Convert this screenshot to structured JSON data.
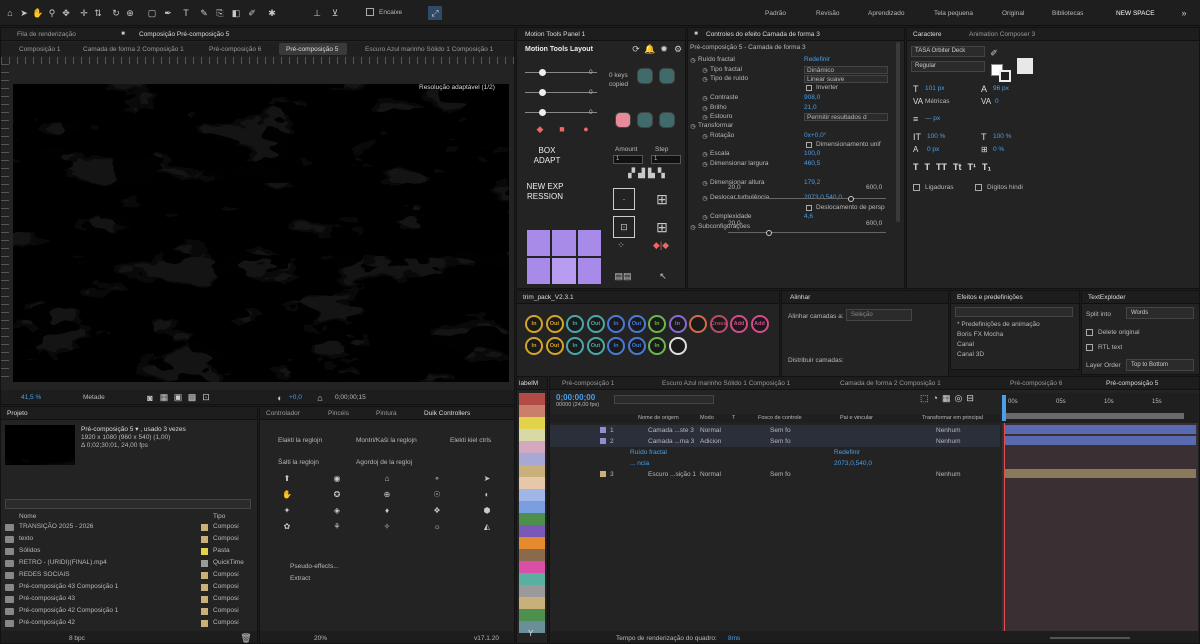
{
  "toolbar": {
    "encaixe": "Encaixe",
    "workspaces": [
      "Padrão",
      "Revisão",
      "Aprendizado",
      "Tela pequena",
      "Original",
      "Bibliotecas",
      "NEW SPACE"
    ]
  },
  "viewer": {
    "tabs": [
      "Fila de renderização",
      "Composição Pré-composição 5"
    ],
    "breadcrumbs": [
      "Composição 1",
      "Camada de forma 2 Composição 1",
      "Pré-composição 6",
      "Pré-composição 5",
      "Escuro Azul marinho Sólido 1 Composição 1"
    ],
    "resolution_label": "Resolução adaptável (1/2)",
    "zoom": "41,5 %",
    "quality": "Metade",
    "exposure": "+0,0",
    "timecode": "0;00;00;15"
  },
  "motion_tools": {
    "tab": "Motion Tools Panel 1",
    "layout": "Motion Tools Layout",
    "slider_values": [
      "0",
      "0",
      "0"
    ],
    "keys_copied": "0 keys copied",
    "box_adapt": "BOX ADAPT",
    "new_expression": "NEW EXPRESSION",
    "amount_label": "Amount",
    "step_label": "Step",
    "amount": "1",
    "step": "1"
  },
  "effects": {
    "tab": "Controles do efeito Camada de forma 3",
    "header": "Pré-composição 5 - Camada de forma 3",
    "rows": [
      {
        "label": "Ruído fractal",
        "value": "Redefinir"
      },
      {
        "label": "Tipo fractal",
        "value": "Dinâmico"
      },
      {
        "label": "Tipo de ruído",
        "value": "Linear suave"
      },
      {
        "label": "",
        "value": "Inverter"
      },
      {
        "label": "Contraste",
        "value": "908,0"
      },
      {
        "label": "Brilho",
        "value": "21,0"
      },
      {
        "label": "Estouro",
        "value": "Permitir resultados d"
      },
      {
        "label": "Transformar",
        "value": ""
      },
      {
        "label": "Rotação",
        "value": "0x+0,0°"
      },
      {
        "label": "",
        "value": "Dimensionamento unif"
      },
      {
        "label": "Escala",
        "value": "100,0"
      },
      {
        "label": "Dimensionar largura",
        "value": "460,5"
      },
      {
        "label": "Dimensionar altura",
        "value": "179,2"
      },
      {
        "label": "Deslocar turbulência",
        "value": "2073,0,540,0"
      },
      {
        "label": "",
        "value": "Deslocamento de persp"
      },
      {
        "label": "Complexidade",
        "value": "4,6"
      },
      {
        "label": "Subconfigurações",
        "value": ""
      }
    ],
    "range_min": "20,0",
    "range_max": "600,0"
  },
  "character": {
    "tabs": [
      "Caractere",
      "Animation Composer 3"
    ],
    "font": "TASA Orbiter Deck",
    "style": "Regular",
    "size": "101 px",
    "leading": "96 px",
    "kerning": "Métricas",
    "tracking": "0",
    "stroke": "— px",
    "vscale": "100 %",
    "hscale": "100 %",
    "baseline": "0 px",
    "tsume": "0 %",
    "ligatures": "Ligaduras",
    "hindi": "Dígitos hindi"
  },
  "trim": {
    "tab": "trim_pack_V2.3.1",
    "buttons": [
      "In",
      "Out",
      "In",
      "Out",
      "In",
      "Out",
      "In",
      "In",
      "",
      "Cross",
      "Add",
      "Add",
      "In",
      "Out",
      "In",
      "Out",
      "In",
      "Out",
      "In",
      ""
    ]
  },
  "align": {
    "tab": "Alinhar",
    "align_to_label": "Alinhar camadas a:",
    "align_to_value": "Seleção",
    "distribute": "Distribuir camadas:"
  },
  "effects_presets": {
    "tab": "Efeitos e predefinições",
    "items": [
      "* Predefinições de animação",
      "Boris FX Mocha",
      "Canal",
      "Canal 3D"
    ]
  },
  "text_exploder": {
    "tab": "TextExploder",
    "split_into": "Split into",
    "split_value": "Words",
    "delete_original": "Delete original",
    "rtl": "RTL text",
    "layer_order": "Layer Order",
    "layer_order_value": "Top to Bottom"
  },
  "project": {
    "tab": "Projeto",
    "comp_name": "Pré-composição 5 ▾ , usado 3 vezes",
    "comp_size": "1920 x 1080  (960 x 540) (1,00)",
    "comp_duration": "Δ 0;02;30;01, 24,00 fps",
    "col_name": "Nome",
    "col_type": "Tipo",
    "bpc": "8 bpc",
    "items": [
      {
        "name": "TRANSIÇÃO 2025 - 2026",
        "type": "Composi",
        "color": "#c9b07a"
      },
      {
        "name": "texto",
        "type": "Composi",
        "color": "#c9b07a"
      },
      {
        "name": "Sólidos",
        "type": "Pasta",
        "color": "#e3d34a"
      },
      {
        "name": "RETRO - (URIDI)(FINAL).mp4",
        "type": "QuickTime",
        "color": "#9a9a9a"
      },
      {
        "name": "REDES SOCIAIS",
        "type": "Composi",
        "color": "#c9b07a"
      },
      {
        "name": "Pré-composição 43 Composição 1",
        "type": "Composi",
        "color": "#c9b07a"
      },
      {
        "name": "Pré-composição 43",
        "type": "Composi",
        "color": "#c9b07a"
      },
      {
        "name": "Pré-composição 42 Composição 1",
        "type": "Composi",
        "color": "#c9b07a"
      },
      {
        "name": "Pré-composição 42",
        "type": "Composi",
        "color": "#c9b07a"
      }
    ]
  },
  "duik": {
    "tabs": [
      "Controlador",
      "Pincéis",
      "Pintura",
      "Duik Controllers"
    ],
    "a": "Elakti la reglojn",
    "b": "Montri/Kaŝi la reglojn",
    "c": "Elekti kiel ctrls",
    "d": "Ŝalti la reglojn",
    "e": "Agordoj de la regloj",
    "pseudo": "Pseudo-effects...",
    "extract": "Extract",
    "version": "v17.1.20",
    "percent": "20%"
  },
  "labels": {
    "tab": "labelM",
    "colors": [
      "#b24b46",
      "#c97f6a",
      "#e3d34a",
      "#d9d9a8",
      "#d4a8bf",
      "#a8a8d4",
      "#c9b07a",
      "#e6c8a8",
      "#9fb6e6",
      "#7a9fe0",
      "#4d8f4d",
      "#7a58b8",
      "#e68a2e",
      "#8a6a4a",
      "#d94fa8",
      "#5ab0a0",
      "#9a9a9a",
      "#c9b07a",
      "#4d8f4d",
      "#6a8f9a"
    ],
    "bottom": "Y"
  },
  "timeline": {
    "tabs": [
      "Pré-composição 1",
      "Escuro Azul marinho Sólido 1 Composição 1",
      "Camada de forma 2 Composição 1",
      "Pré-composição 6",
      "Pré-composição 5"
    ],
    "timecode": "0;00:00;00",
    "frames": "00000 (24,00 fps)",
    "cols": [
      "Nome de origem",
      "Modo",
      "T",
      "Fosco de controle",
      "Pai e vincular",
      "Transformar em principal"
    ],
    "ruler": [
      "00s",
      "05s",
      "10s",
      "15s"
    ],
    "layers": [
      {
        "num": "1",
        "name": "Camada ...ste 3",
        "mode": "Normal",
        "matte": "Sem fo",
        "parent": "Nenhum",
        "color": "#8f8fd0"
      },
      {
        "num": "2",
        "name": "Camada ...ma 3",
        "mode": "Adicion",
        "matte": "Sem fo",
        "parent": "Nenhum",
        "color": "#8f8fd0"
      },
      {
        "num": "",
        "name": "Ruído fractal",
        "mode": "",
        "matte": "Redefinir",
        "parent": "",
        "color": ""
      },
      {
        "num": "",
        "name": "... ncia",
        "mode": "",
        "matte": "2073,0,540,0",
        "parent": "",
        "color": ""
      },
      {
        "num": "3",
        "name": "Escuro ...sição 1",
        "mode": "Normal",
        "matte": "Sem fo",
        "parent": "Nenhum",
        "color": "#c9b07a"
      }
    ],
    "render_time": "Tempo de renderização do quadro:",
    "render_value": "8ms"
  }
}
